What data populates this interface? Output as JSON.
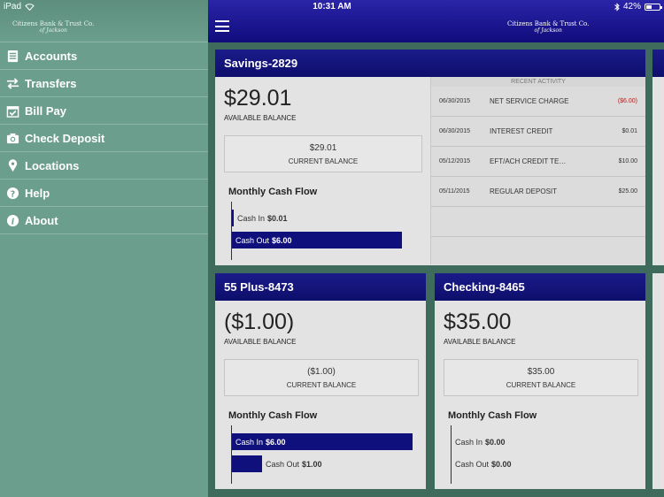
{
  "status_bar": {
    "device": "iPad",
    "time": "10:31 AM",
    "battery": "42%",
    "battery_level": 0.42
  },
  "brand": {
    "name": "Citizens Bank & Trust Co.",
    "sub": "of Jackson"
  },
  "sidebar": {
    "items": [
      {
        "label": "Accounts",
        "icon": "accounts-icon"
      },
      {
        "label": "Transfers",
        "icon": "transfer-arrows-icon"
      },
      {
        "label": "Bill Pay",
        "icon": "calendar-check-icon"
      },
      {
        "label": "Check Deposit",
        "icon": "camera-icon"
      },
      {
        "label": "Locations",
        "icon": "map-pin-icon"
      },
      {
        "label": "Help",
        "icon": "question-icon"
      },
      {
        "label": "About",
        "icon": "info-icon"
      }
    ]
  },
  "colors": {
    "sidebar": "#6c9e8e",
    "header": "#11117a",
    "bar": "#10107c",
    "negative": "#b32020"
  },
  "labels": {
    "available_balance": "AVAILABLE BALANCE",
    "current_balance": "CURRENT BALANCE",
    "monthly_cash_flow": "Monthly Cash Flow",
    "cash_in": "Cash In",
    "cash_out": "Cash Out",
    "recent_activity": "RECENT ACTIVITY"
  },
  "accounts": [
    {
      "name": "Savings-2829",
      "available": "$29.01",
      "current": "$29.01",
      "cash_in": "$0.01",
      "cash_out": "$6.00",
      "cash_in_ratio": 0.0017,
      "cash_out_ratio": 1.0
    },
    {
      "name": "55 Plus-8473",
      "available": "($1.00)",
      "current": "($1.00)",
      "cash_in": "$6.00",
      "cash_out": "$1.00",
      "cash_in_ratio": 1.0,
      "cash_out_ratio": 0.167
    },
    {
      "name": "Checking-8465",
      "available": "$35.00",
      "current": "$35.00",
      "cash_in": "$0.00",
      "cash_out": "$0.00",
      "cash_in_ratio": 0.0,
      "cash_out_ratio": 0.0
    }
  ],
  "recent_activity": [
    {
      "date": "06/30/2015",
      "desc": "NET SERVICE CHARGE",
      "amount": "($6.00)",
      "negative": true
    },
    {
      "date": "06/30/2015",
      "desc": "INTEREST CREDIT",
      "amount": "$0.01",
      "negative": false
    },
    {
      "date": "05/12/2015",
      "desc": "EFT/ACH CREDIT TE…",
      "amount": "$10.00",
      "negative": false
    },
    {
      "date": "05/11/2015",
      "desc": "REGULAR DEPOSIT",
      "amount": "$25.00",
      "negative": false
    }
  ]
}
